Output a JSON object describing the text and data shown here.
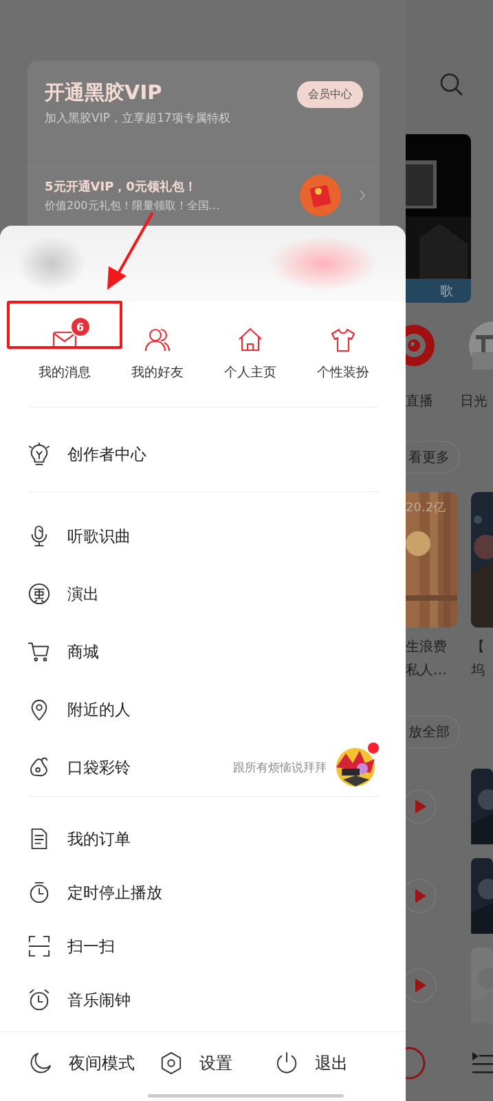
{
  "vip_card": {
    "title": "开通黑胶VIP",
    "subtitle": "加入黑胶VIP，立享超17项专属特权",
    "button": "会员中心",
    "promo_title": "5元开通VIP，0元领礼包！",
    "promo_subtitle": "价值200元礼包！限量领取！全国…"
  },
  "quick_actions": [
    {
      "label": "我的消息",
      "kind": "mail",
      "badge": "6"
    },
    {
      "label": "我的好友",
      "kind": "friends"
    },
    {
      "label": "个人主页",
      "kind": "home"
    },
    {
      "label": "个性装扮",
      "kind": "shirt"
    }
  ],
  "menu_sections": [
    {
      "items": [
        {
          "label": "创作者中心",
          "kind": "bulb"
        }
      ]
    },
    {
      "items": [
        {
          "label": "听歌识曲",
          "kind": "mic"
        },
        {
          "label": "演出",
          "kind": "ticket"
        },
        {
          "label": "商城",
          "kind": "cart"
        },
        {
          "label": "附近的人",
          "kind": "pin"
        },
        {
          "label": "口袋彩铃",
          "kind": "bell",
          "hint": "跟所有烦恼说拜拜"
        }
      ]
    },
    {
      "items": [
        {
          "label": "我的订单",
          "kind": "doc"
        },
        {
          "label": "定时停止播放",
          "kind": "timer"
        },
        {
          "label": "扫一扫",
          "kind": "scan"
        },
        {
          "label": "音乐闹钟",
          "kind": "alarm"
        }
      ]
    }
  ],
  "bottom_bar": [
    {
      "label": "夜间模式",
      "kind": "moon"
    },
    {
      "label": "设置",
      "kind": "settings"
    },
    {
      "label": "退出",
      "kind": "power"
    }
  ],
  "background_page": {
    "video_caption": "歌",
    "channels": [
      {
        "label": "直播"
      },
      {
        "label": "日光"
      }
    ],
    "more_button": "看更多",
    "play_count": "20.2亿",
    "playlists": [
      {
        "lines": [
          "生浪费",
          "私人…"
        ]
      },
      {
        "lines": [
          "【",
          "坞"
        ]
      }
    ],
    "play_all_button": "放全部"
  }
}
